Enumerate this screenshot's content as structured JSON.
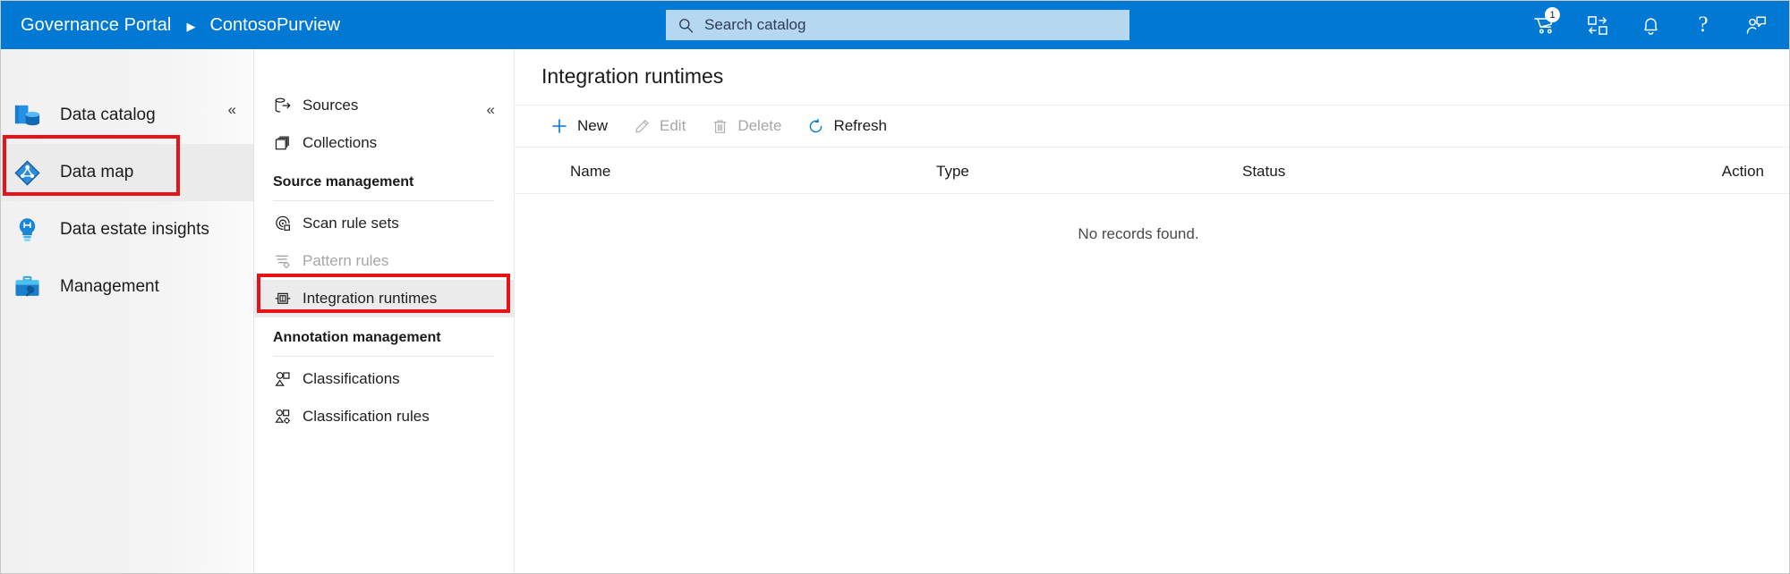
{
  "colors": {
    "brand_blue": "#0078d4",
    "search_bg": "#b6d7f0",
    "highlight_red": "#e8121a",
    "selected_row": "#ebebeb",
    "disabled_text": "#a6a6a6"
  },
  "header": {
    "product_title": "Governance Portal",
    "separator": "▶",
    "account_name": "ContosoPurview",
    "search": {
      "placeholder": "Search catalog",
      "value": "",
      "icon": "search-icon"
    },
    "icons": [
      {
        "name": "cart-icon",
        "label": "Shopping cart",
        "badge": "1"
      },
      {
        "name": "data-share-icon",
        "label": "Data share",
        "badge": ""
      },
      {
        "name": "bell-icon",
        "label": "Notifications",
        "badge": ""
      },
      {
        "name": "help-icon",
        "label": "?",
        "badge": ""
      },
      {
        "name": "feedback-icon",
        "label": "Feedback",
        "badge": ""
      }
    ]
  },
  "sidebar": {
    "collapse_label": "«",
    "items": [
      {
        "label": "Data catalog",
        "icon": "data-catalog-icon",
        "selected": false
      },
      {
        "label": "Data map",
        "icon": "data-map-icon",
        "selected": true
      },
      {
        "label": "Data estate insights",
        "icon": "data-estate-insights-icon",
        "selected": false
      },
      {
        "label": "Management",
        "icon": "management-icon",
        "selected": false
      }
    ]
  },
  "nav_panel": {
    "collapse_label": "«",
    "entries": [
      {
        "kind": "item",
        "label": "Sources",
        "icon": "sources-icon",
        "selected": false,
        "disabled": false
      },
      {
        "kind": "item",
        "label": "Collections",
        "icon": "collections-icon",
        "selected": false,
        "disabled": false
      },
      {
        "kind": "group",
        "label": "Source management"
      },
      {
        "kind": "item",
        "label": "Scan rule sets",
        "icon": "scan-rule-sets-icon",
        "selected": false,
        "disabled": false
      },
      {
        "kind": "item",
        "label": "Pattern rules",
        "icon": "pattern-rules-icon",
        "selected": false,
        "disabled": true
      },
      {
        "kind": "item",
        "label": "Integration runtimes",
        "icon": "integration-runtimes-icon",
        "selected": true,
        "disabled": false
      },
      {
        "kind": "group",
        "label": "Annotation management"
      },
      {
        "kind": "item",
        "label": "Classifications",
        "icon": "classifications-icon",
        "selected": false,
        "disabled": false
      },
      {
        "kind": "item",
        "label": "Classification rules",
        "icon": "classification-rules-icon",
        "selected": false,
        "disabled": false
      }
    ]
  },
  "main": {
    "page_title": "Integration runtimes",
    "toolbar": [
      {
        "label": "New",
        "icon": "plus-icon",
        "disabled": false
      },
      {
        "label": "Edit",
        "icon": "pencil-icon",
        "disabled": true
      },
      {
        "label": "Delete",
        "icon": "trash-icon",
        "disabled": true
      },
      {
        "label": "Refresh",
        "icon": "refresh-icon",
        "disabled": false
      }
    ],
    "table": {
      "columns": [
        "Name",
        "Type",
        "Status",
        "Action"
      ],
      "rows": [],
      "empty_message": "No records found."
    }
  },
  "annotations": [
    {
      "name": "highlight-data-map",
      "target": "Data map"
    },
    {
      "name": "highlight-integration-runtimes",
      "target": "Integration runtimes"
    }
  ]
}
